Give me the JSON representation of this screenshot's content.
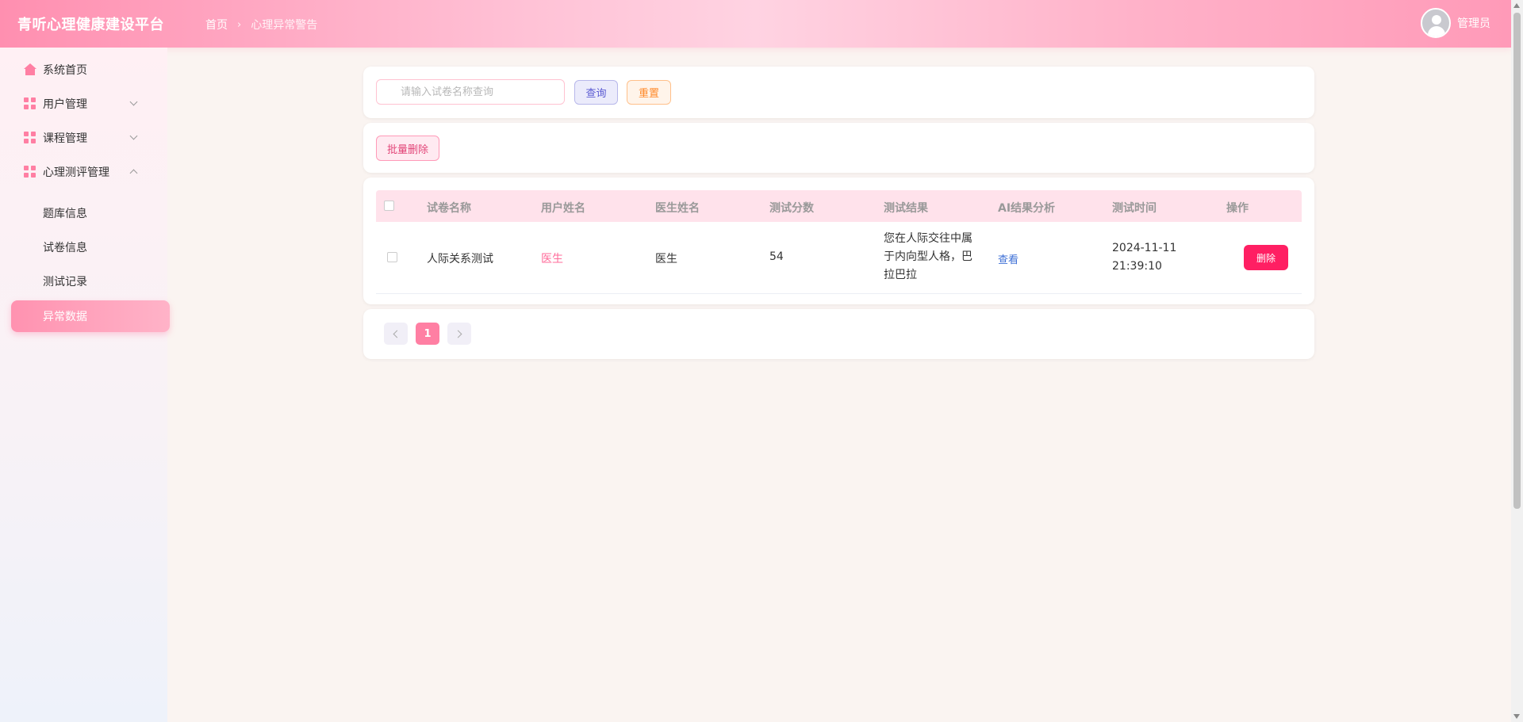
{
  "header": {
    "brand": "青听心理健康建设平台",
    "breadcrumb": [
      "首页",
      "心理异常警告"
    ],
    "user_name": "管理员"
  },
  "sidebar": {
    "items": [
      {
        "label": "系统首页",
        "icon": "home-icon"
      },
      {
        "label": "用户管理",
        "icon": "grid-icon"
      },
      {
        "label": "课程管理",
        "icon": "grid-icon"
      },
      {
        "label": "心理测评管理",
        "icon": "grid-icon"
      }
    ],
    "sub_items": [
      "题库信息",
      "试卷信息",
      "测试记录",
      "异常数据"
    ],
    "active": "异常数据"
  },
  "search": {
    "placeholder": "请输入试卷名称查询",
    "query_label": "查询",
    "reset_label": "重置"
  },
  "toolbar": {
    "batch_delete_label": "批量删除"
  },
  "table": {
    "columns": [
      "试卷名称",
      "用户姓名",
      "医生姓名",
      "测试分数",
      "测试结果",
      "AI结果分析",
      "测试时间",
      "操作"
    ],
    "rows": [
      {
        "paper": "人际关系测试",
        "user": "医生",
        "doctor": "医生",
        "score": "54",
        "result": "您在人际交往中属于内向型人格，巴拉巴拉",
        "ai_link": "查看",
        "time": "2024-11-11 21:39:10",
        "action": "删除"
      }
    ]
  },
  "pagination": {
    "current": "1"
  },
  "colors": {
    "accent": "#ff7fa3",
    "danger": "#ff1f63",
    "header_gradient_start": "#ff8fb0"
  }
}
